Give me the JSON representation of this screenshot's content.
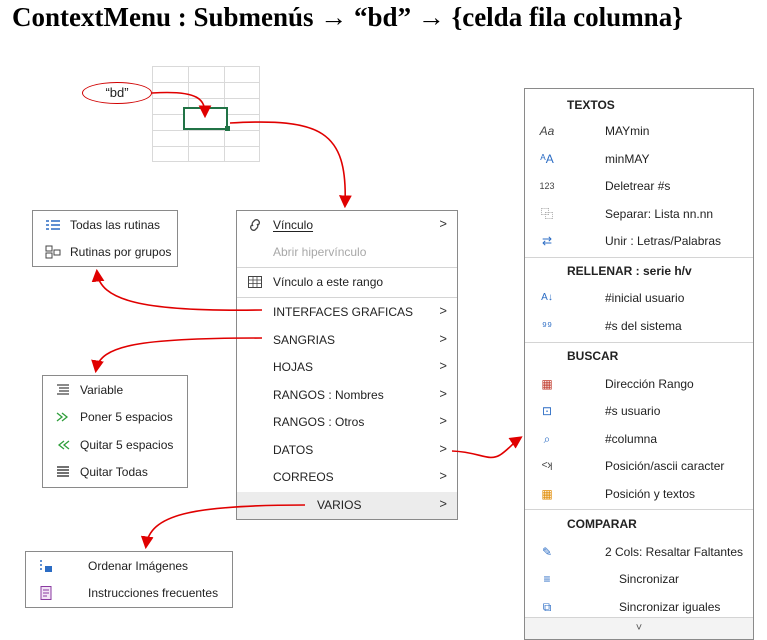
{
  "title": "ContextMenu : Submenús → “bd” → {celda fila columna}",
  "bubble_label": "“bd”",
  "main_menu": {
    "items": [
      {
        "label": "Vínculo",
        "icon": "link-icon",
        "chev": ">"
      },
      {
        "label": "Abrir hipervínculo"
      },
      {
        "label": "Vínculo a este rango",
        "icon": "table-link-icon"
      },
      {
        "label": "INTERFACES GRAFICAS",
        "chev": ">"
      },
      {
        "label": "SANGRIAS",
        "chev": ">"
      },
      {
        "label": "HOJAS",
        "chev": ">"
      },
      {
        "label": "RANGOS : Nombres",
        "chev": ">"
      },
      {
        "label": "RANGOS : Otros",
        "chev": ">"
      },
      {
        "label": "DATOS",
        "chev": ">"
      },
      {
        "label": "CORREOS",
        "chev": ">"
      },
      {
        "label": "VARIOS",
        "chev": ">"
      }
    ]
  },
  "rutinas_menu": {
    "items": [
      {
        "label": "Todas las rutinas",
        "icon": "list-icon"
      },
      {
        "label": "Rutinas por grupos",
        "icon": "groups-icon"
      }
    ]
  },
  "sangrias_menu": {
    "items": [
      {
        "label": "Variable",
        "icon": "lines-icon"
      },
      {
        "label": "Poner 5 espacios",
        "icon": "indent-right-icon"
      },
      {
        "label": "Quitar 5 espacios",
        "icon": "indent-left-icon"
      },
      {
        "label": "Quitar Todas",
        "icon": "lines-all-icon"
      }
    ]
  },
  "varios_menu": {
    "items": [
      {
        "label": "Ordenar Imágenes",
        "icon": "sort-images-icon"
      },
      {
        "label": "Instrucciones frecuentes",
        "icon": "instructions-icon"
      }
    ]
  },
  "datos_menu": {
    "sections": [
      {
        "header": "TEXTOS",
        "items": [
          {
            "label": "MAYmin",
            "icon_text": "Aa"
          },
          {
            "label": "minMAY",
            "icon_text": "ᴬA"
          },
          {
            "label": "Deletrear #s",
            "icon_text": "123"
          },
          {
            "label": "Separar: Lista nn.nn",
            "icon_text": "⿻"
          },
          {
            "label": "Unir : Letras/Palabras",
            "icon_text": "⇄"
          }
        ]
      },
      {
        "header": "RELLENAR : serie h/v",
        "items": [
          {
            "label": "#inicial usuario",
            "icon_text": "A↓"
          },
          {
            "label": "#s del sistema",
            "icon_text": "⁹⁹"
          }
        ]
      },
      {
        "header": "BUSCAR",
        "items": [
          {
            "label": "Dirección Rango",
            "icon_text": "▦"
          },
          {
            "label": "#s usuario",
            "icon_text": "⊡"
          },
          {
            "label": "#columna",
            "icon_text": "⌕"
          },
          {
            "label": "Posición/ascii caracter",
            "icon_text": "<ʞ"
          },
          {
            "label": "Posición y textos",
            "icon_text": "▦"
          }
        ]
      },
      {
        "header": "COMPARAR",
        "items": [
          {
            "label": "2 Cols: Resaltar Faltantes",
            "icon_text": "✎"
          },
          {
            "label": "Sincronizar",
            "icon_text": "≡"
          },
          {
            "label": "Sincronizar iguales",
            "icon_text": "⧉"
          }
        ]
      }
    ],
    "scroll_label": "˅"
  },
  "colors": {
    "arrow": "#e00000",
    "selection": "#217346",
    "accent_icon": "#2b6cc4"
  }
}
